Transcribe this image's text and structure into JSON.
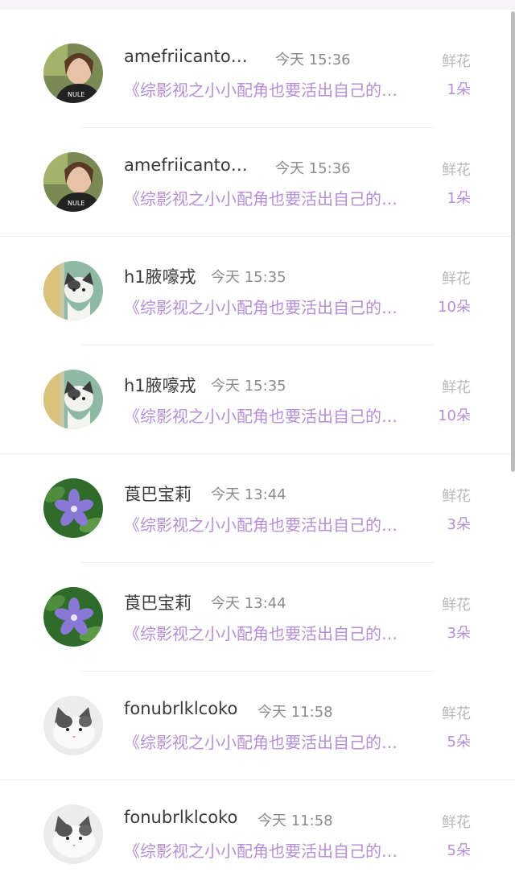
{
  "list": {
    "items": [
      {
        "username": "amefriicanto…",
        "time": "今天 15:36",
        "flower_label": "鲜花",
        "book": "《综影视之小小配角也要活出自己的…",
        "count": "1朵",
        "avatar": "photo-girl-avatar"
      },
      {
        "username": "amefriicanto…",
        "time": "今天 15:36",
        "flower_label": "鲜花",
        "book": "《综影视之小小配角也要活出自己的…",
        "count": "1朵",
        "avatar": "photo-girl-avatar"
      },
      {
        "username": "h1腋嚎戎",
        "time": "今天 15:35",
        "flower_label": "鲜花",
        "book": "《综影视之小小配角也要活出自己的…",
        "count": "10朵",
        "avatar": "cat-peeking-avatar"
      },
      {
        "username": "h1腋嚎戎",
        "time": "今天 15:35",
        "flower_label": "鲜花",
        "book": "《综影视之小小配角也要活出自己的…",
        "count": "10朵",
        "avatar": "cat-peeking-avatar"
      },
      {
        "username": "莨巴宝莉",
        "time": "今天 13:44",
        "flower_label": "鲜花",
        "book": "《综影视之小小配角也要活出自己的…",
        "count": "3朵",
        "avatar": "purple-flower-avatar"
      },
      {
        "username": "莨巴宝莉",
        "time": "今天 13:44",
        "flower_label": "鲜花",
        "book": "《综影视之小小配角也要活出自己的…",
        "count": "3朵",
        "avatar": "purple-flower-avatar"
      },
      {
        "username": "fonubrlklcoko",
        "time": "今天 11:58",
        "flower_label": "鲜花",
        "book": "《综影视之小小配角也要活出自己的…",
        "count": "5朵",
        "avatar": "white-cat-avatar"
      },
      {
        "username": "fonubrlklcoko",
        "time": "今天 11:58",
        "flower_label": "鲜花",
        "book": "《综影视之小小配角也要活出自己的…",
        "count": "5朵",
        "avatar": "white-cat-avatar"
      }
    ]
  },
  "colors": {
    "accent_purple": "#b58ed6",
    "name_text": "#3a3a3a",
    "time_text": "#8b8b8b",
    "label_text": "#b8b8b8"
  }
}
